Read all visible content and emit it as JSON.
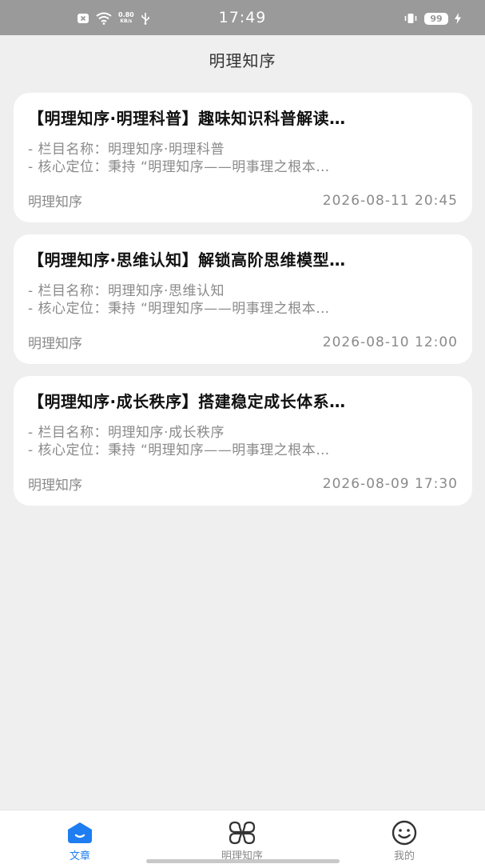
{
  "status_bar": {
    "net_speed_value": "0.80",
    "net_speed_unit": "KB/s",
    "time": "17:49",
    "battery": "99"
  },
  "header": {
    "title": "明理知序"
  },
  "articles": [
    {
      "title": "【明理知序·明理科普】趣味知识科普解读…",
      "line1": "- 栏目名称：明理知序·明理科普",
      "line2": "- 核心定位：秉持 “明理知序——明事理之根本…",
      "source": "明理知序",
      "date": "2026-08-11 20:45"
    },
    {
      "title": "【明理知序·思维认知】解锁高阶思维模型…",
      "line1": "- 栏目名称：明理知序·思维认知",
      "line2": "- 核心定位：秉持 “明理知序——明事理之根本…",
      "source": "明理知序",
      "date": "2026-08-10 12:00"
    },
    {
      "title": "【明理知序·成长秩序】搭建稳定成长体系…",
      "line1": "- 栏目名称：明理知序·成长秩序",
      "line2": "- 核心定位：秉持 “明理知序——明事理之根本…",
      "source": "明理知序",
      "date": "2026-08-09 17:30"
    }
  ],
  "bottom_nav": {
    "items": [
      {
        "label": "文章",
        "icon": "article-home-icon",
        "active": true
      },
      {
        "label": "明理知序",
        "icon": "four-petal-icon",
        "active": false
      },
      {
        "label": "我的",
        "icon": "smiley-face-icon",
        "active": false
      }
    ]
  },
  "colors": {
    "accent": "#1e7df0",
    "status_bar": "#9a9a9a",
    "background": "#efefef"
  }
}
